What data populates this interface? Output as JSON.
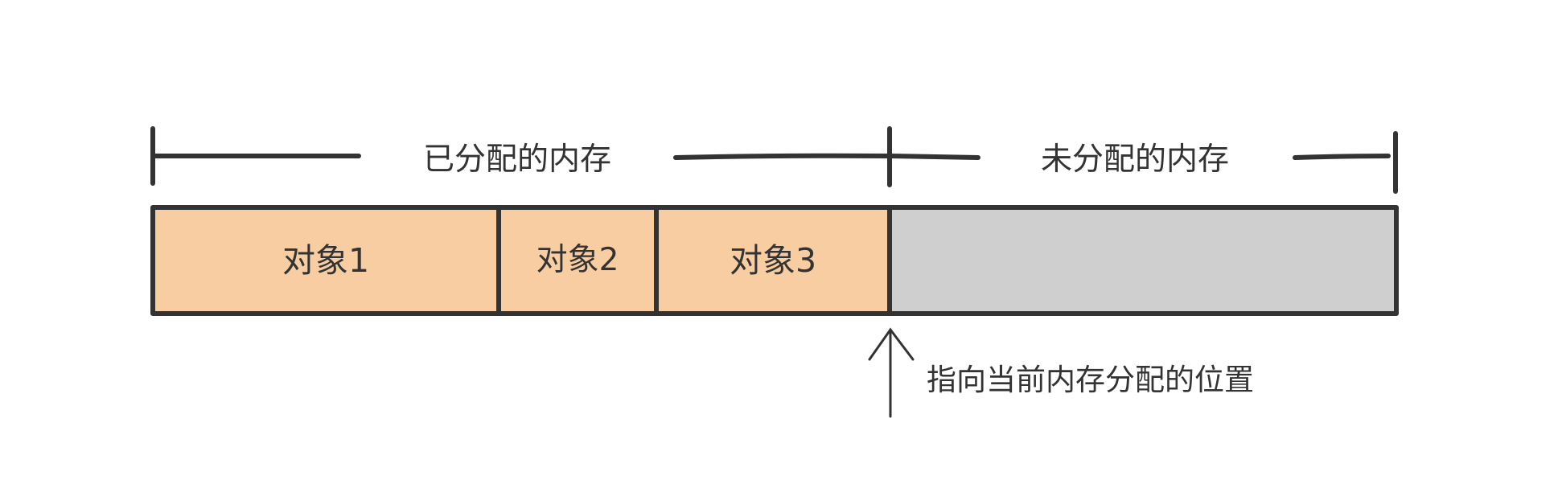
{
  "colors": {
    "stroke": "#333333",
    "allocated_fill": "#f8cda1",
    "unallocated_fill": "#cfcfcf",
    "background": "#ffffff"
  },
  "allocated_label": "已分配的内存",
  "unallocated_label": "未分配的内存",
  "objects": [
    {
      "label": "对象1"
    },
    {
      "label": "对象2"
    },
    {
      "label": "对象3"
    }
  ],
  "pointer_label": "指向当前内存分配的位置"
}
